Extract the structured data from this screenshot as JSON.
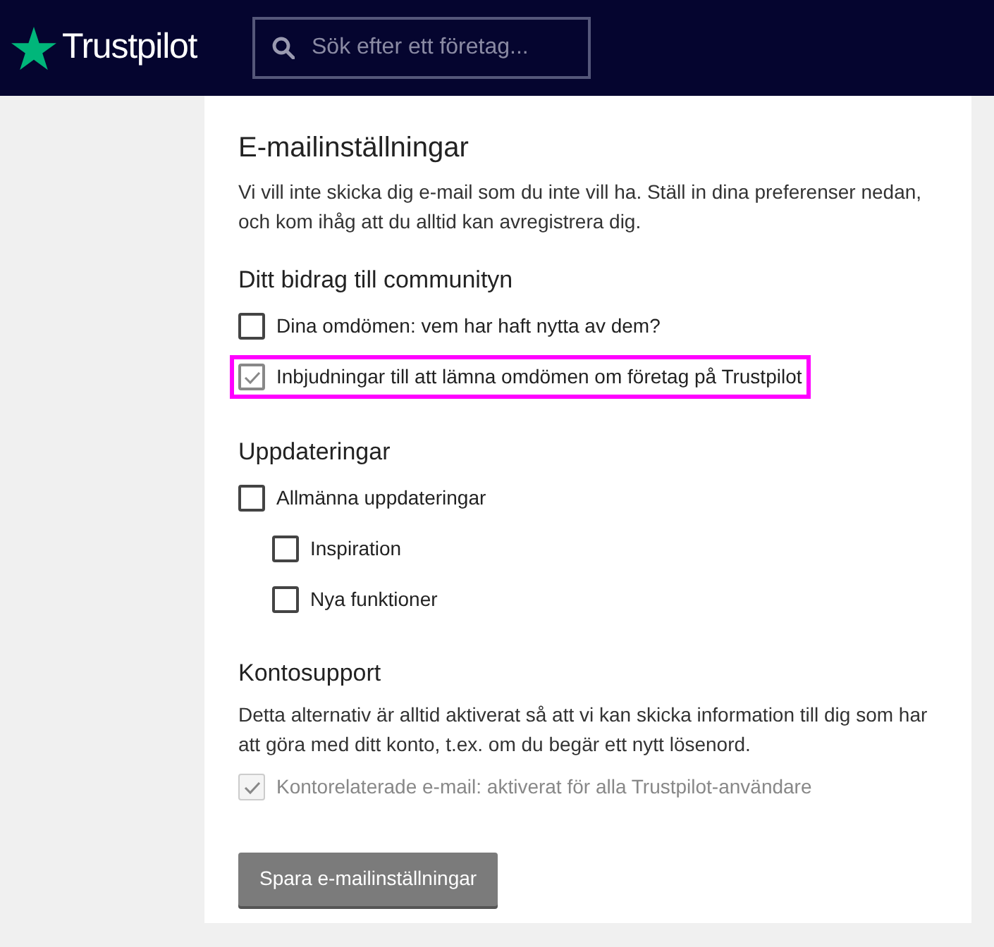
{
  "header": {
    "logo": "Trustpilot",
    "search": {
      "placeholder": "Sök efter ett företag..."
    }
  },
  "title": "E-mailinställningar",
  "intro": "Vi vill inte skicka dig e-mail som du inte vill ha. Ställ in dina preferenser nedan, och kom ihåg att du alltid kan avregistrera dig.",
  "sections": [
    {
      "heading": "Ditt bidrag till communityn",
      "options": [
        {
          "label": "Dina omdömen: vem har haft nytta av dem?",
          "checked": false,
          "disabled": false,
          "highlighted": false
        },
        {
          "label": "Inbjudningar till att lämna omdömen om företag på Trustpilot",
          "checked": true,
          "disabled": false,
          "highlighted": true
        }
      ]
    },
    {
      "heading": "Uppdateringar",
      "options": [
        {
          "label": "Allmänna uppdateringar",
          "checked": false,
          "disabled": false,
          "highlighted": false,
          "children": [
            {
              "label": "Inspiration",
              "checked": false,
              "disabled": false,
              "highlighted": false
            },
            {
              "label": "Nya funktioner",
              "checked": false,
              "disabled": false,
              "highlighted": false
            }
          ]
        }
      ]
    },
    {
      "heading": "Kontosupport",
      "description": "Detta alternativ är alltid aktiverat så att vi kan skicka information till dig som har att göra med ditt konto, t.ex. om du begär ett nytt lösenord.",
      "options": [
        {
          "label": "Kontorelaterade e-mail: aktiverat för alla Trustpilot-användare",
          "checked": true,
          "disabled": true,
          "highlighted": false
        }
      ]
    }
  ],
  "save_button": "Spara e-mailinställningar"
}
